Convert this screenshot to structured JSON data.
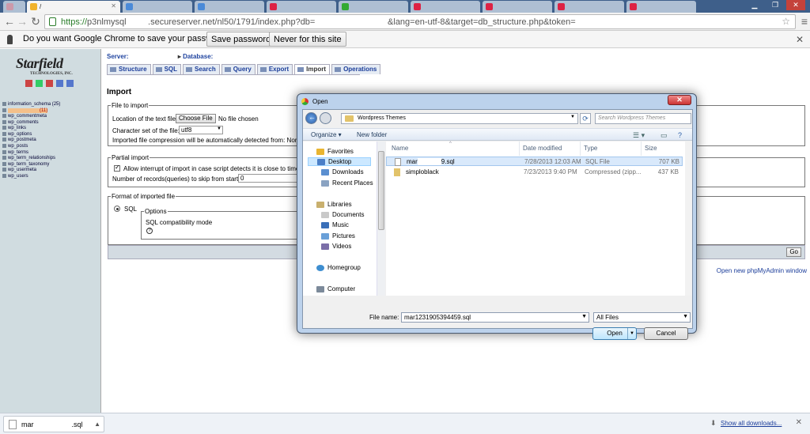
{
  "browser": {
    "tabs": [
      {
        "title": "/",
        "active": true
      },
      {
        "title": "",
        "active": false
      },
      {
        "title": "",
        "active": false
      },
      {
        "title": "",
        "active": false
      },
      {
        "title": "",
        "active": false
      },
      {
        "title": "",
        "active": false
      },
      {
        "title": "",
        "active": false
      },
      {
        "title": "",
        "active": false
      },
      {
        "title": "",
        "active": false
      }
    ],
    "url_scheme": "https://",
    "url_rest": "p3nlmysql         .secureserver.net/nl50/1791/index.php?db=                              &lang=en-utf-8&target=db_structure.php&token="
  },
  "password_bar": {
    "prompt": "Do you want Google Chrome to save your password?",
    "save_label": "Save password",
    "never_label": "Never for this site",
    "close_glyph": "✕"
  },
  "left_pane": {
    "logo": "Starfield",
    "logo_sub": "TECHNOLOGIES, INC.",
    "databases": [
      {
        "label": "information_schema (25)"
      },
      {
        "label": "(11)",
        "selected": true
      },
      {
        "label": "wp_commentmeta"
      },
      {
        "label": "wp_comments"
      },
      {
        "label": "wp_links"
      },
      {
        "label": "wp_options"
      },
      {
        "label": "wp_postmeta"
      },
      {
        "label": "wp_posts"
      },
      {
        "label": "wp_terms"
      },
      {
        "label": "wp_term_relationships"
      },
      {
        "label": "wp_term_taxonomy"
      },
      {
        "label": "wp_usermeta"
      },
      {
        "label": "wp_users"
      }
    ]
  },
  "pma": {
    "server_label": "Server:",
    "database_label": "Database:",
    "tabs": [
      "Structure",
      "SQL",
      "Search",
      "Query",
      "Export",
      "Import",
      "Operations"
    ],
    "heading": "Import",
    "file_legend": "File to import",
    "location_label": "Location of the text file",
    "choose_label": "Choose File",
    "no_file": "No file chosen",
    "charset_label": "Character set of the file:",
    "charset_value": "utf8",
    "compression_text": "Imported file compression will be automatically detected from: Non",
    "partial_legend": "Partial import",
    "allow_interrupt": "Allow interrupt of import in case script detects it is close to time",
    "skip_label": "Number of records(queries) to skip from start",
    "skip_value": "0",
    "format_legend": "Format of imported file",
    "format_sql": "SQL",
    "options_legend": "Options",
    "compat_label": "SQL compatibility mode",
    "help_glyph": "?",
    "go_label": "Go",
    "open_new": "Open new phpMyAdmin window"
  },
  "dialog": {
    "title": "Open",
    "close_glyph": "✕",
    "breadcrumb": "Wordpress Themes",
    "search_placeholder": "Search Wordpress Themes",
    "organize": "Organize ▾",
    "new_folder": "New folder",
    "tree": {
      "favorites": "Favorites",
      "desktop": "Desktop",
      "downloads": "Downloads",
      "recent": "Recent Places",
      "libraries": "Libraries",
      "documents": "Documents",
      "music": "Music",
      "pictures": "Pictures",
      "videos": "Videos",
      "homegroup": "Homegroup",
      "computer": "Computer"
    },
    "columns": {
      "name": "Name",
      "date": "Date modified",
      "type": "Type",
      "size": "Size"
    },
    "files": [
      {
        "name_a": "mar",
        "name_b": "9.sql",
        "date": "7/28/2013 12:03 AM",
        "type": "SQL File",
        "size": "707 KB",
        "selected": true
      },
      {
        "name_a": "simploblack",
        "name_b": "",
        "date": "7/23/2013 9:40 PM",
        "type": "Compressed (zipp...",
        "size": "437 KB",
        "selected": false
      }
    ],
    "filename_label": "File name:",
    "filename_value": "mar1231905394459.sql",
    "filetype_value": "All Files",
    "open_label": "Open",
    "cancel_label": "Cancel"
  },
  "download_shelf": {
    "file_a": "mar",
    "file_b": ".sql",
    "show_all": "Show all downloads...",
    "close_glyph": "✕"
  },
  "colors": {
    "tabbar": "#3e5f8a",
    "left_pane": "#d0dce0",
    "dialog_frame": "#bcd2ec",
    "link": "#1b3d9a"
  }
}
